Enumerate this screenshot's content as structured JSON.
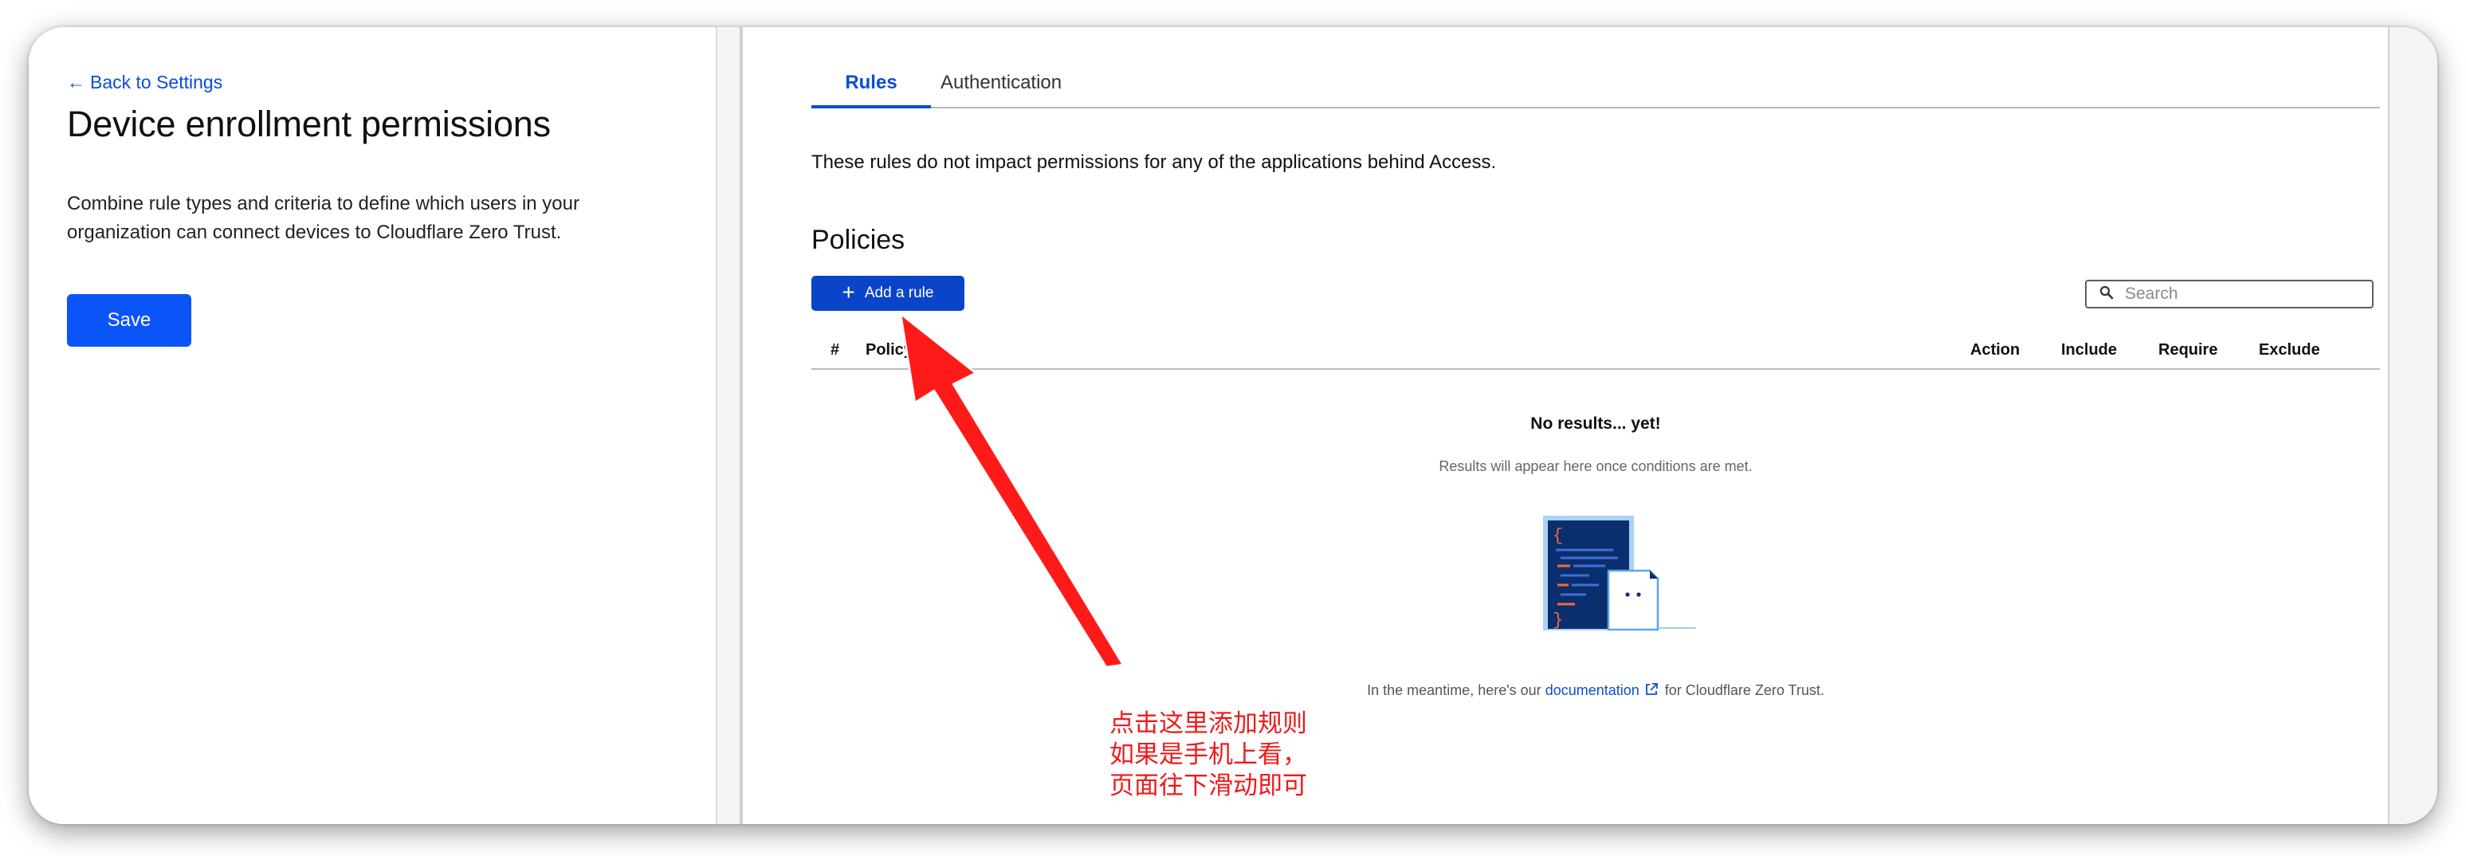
{
  "left_panel": {
    "back_label": "Back to Settings",
    "title": "Device enrollment permissions",
    "description": "Combine rule types and criteria to define which users in your organization can connect devices to Cloudflare Zero Trust.",
    "save_label": "Save"
  },
  "tabs": [
    {
      "label": "Rules",
      "active": true
    },
    {
      "label": "Authentication",
      "active": false
    }
  ],
  "info_text": "These rules do not impact permissions for any of the applications behind Access.",
  "policies": {
    "title": "Policies",
    "add_rule_label": "Add a rule",
    "search_placeholder": "Search",
    "columns": [
      "#",
      "Policy",
      "Action",
      "Include",
      "Require",
      "Exclude"
    ],
    "empty_title": "No results... yet!",
    "empty_subtitle": "Results will appear here once conditions are met.",
    "meantime_prefix": "In the meantime, here's our",
    "documentation_label": "documentation",
    "meantime_suffix": "for Cloudflare Zero Trust."
  },
  "annotation": {
    "text": "点击这里添加规则\n如果是手机上看，\n页面往下滑动即可",
    "color": "#ee1b1b"
  },
  "icons": {
    "back": "arrow-left-icon",
    "add": "plus-icon",
    "search": "search-icon",
    "external_link": "external-link-icon"
  },
  "colors": {
    "accent": "#0b55f8",
    "link": "#0b4dd6",
    "add_button": "#0a44c8"
  }
}
